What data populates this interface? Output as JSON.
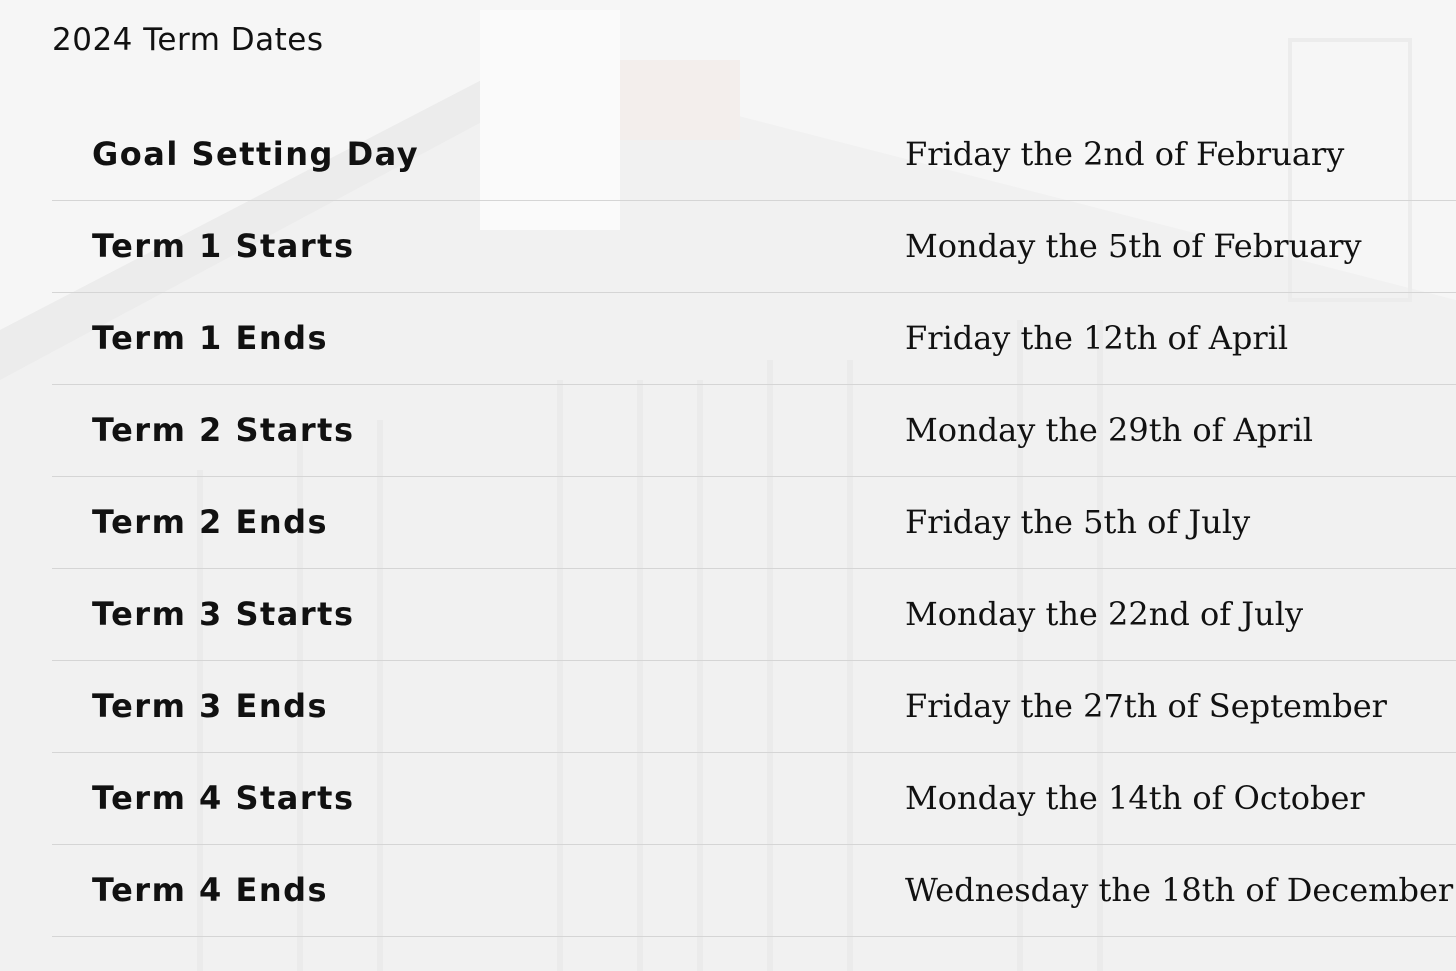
{
  "page": {
    "title": "2024 Term Dates"
  },
  "term_dates": [
    {
      "event": "Goal Setting Day",
      "date": "Friday the 2nd of February"
    },
    {
      "event": "Term 1 Starts",
      "date": "Monday the 5th of February"
    },
    {
      "event": "Term 1 Ends",
      "date": "Friday the 12th of April"
    },
    {
      "event": "Term 2 Starts",
      "date": "Monday the 29th of April"
    },
    {
      "event": "Term 2 Ends",
      "date": "Friday the 5th of July"
    },
    {
      "event": "Term 3 Starts",
      "date": "Monday the 22nd of July"
    },
    {
      "event": "Term 3 Ends",
      "date": "Friday the 27th of September"
    },
    {
      "event": "Term 4 Starts",
      "date": "Monday the 14th of October"
    },
    {
      "event": "Term 4 Ends",
      "date": "Wednesday the 18th of December"
    }
  ],
  "colors": {
    "background": "#f6f6f6",
    "text": "#111111",
    "divider": "#d5d5d5"
  }
}
